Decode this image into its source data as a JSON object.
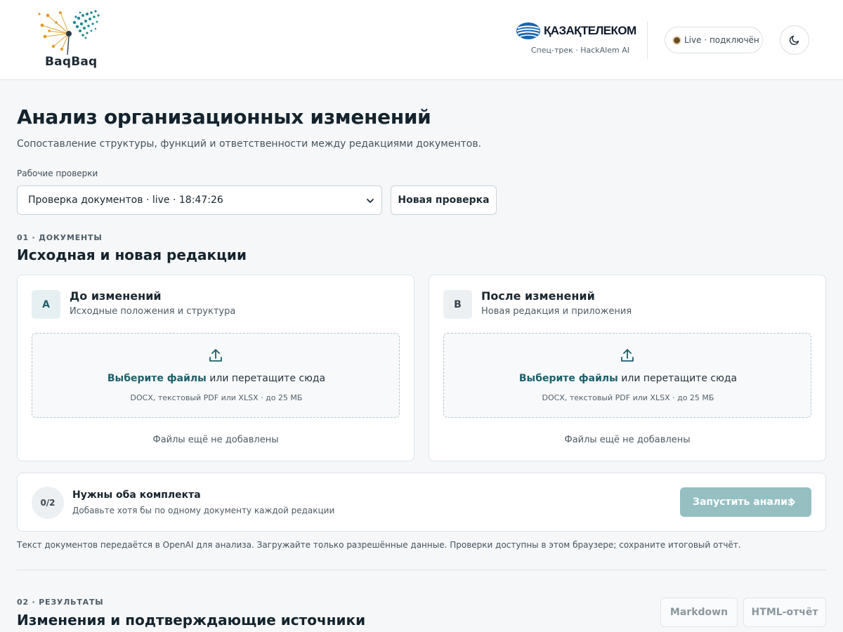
{
  "header": {
    "logo_text": "BaqBaq",
    "partner_name": "ҚАЗАҚТЕЛЕКОМ",
    "partner_sub": "Спец-трек · HackAlem AI",
    "live_status": "Live · подключён"
  },
  "main": {
    "title": "Анализ организационных изменений",
    "subtitle": "Сопоставление структуры, функций и ответственности между редакциями документов.",
    "checks_label": "Рабочие проверки",
    "selected_check": "Проверка документов · live · 18:47:26",
    "new_check_label": "Новая проверка"
  },
  "documents": {
    "kicker": "01 · ДОКУМЕНТЫ",
    "title": "Исходная и новая редакции",
    "cards": [
      {
        "badge": "A",
        "title": "До изменений",
        "subtitle": "Исходные положения и структура",
        "drop_link": "Выберите файлы",
        "drop_text": " или перетащите сюда",
        "drop_hint": "DOCX, текстовый PDF или XLSX · до 25 МБ",
        "empty_text": "Файлы ещё не добавлены"
      },
      {
        "badge": "B",
        "title": "После изменений",
        "subtitle": "Новая редакция и приложения",
        "drop_link": "Выберите файлы",
        "drop_text": " или перетащите сюда",
        "drop_hint": "DOCX, текстовый PDF или XLSX · до 25 МБ",
        "empty_text": "Файлы ещё не добавлены"
      }
    ],
    "status": {
      "counter": "0/2",
      "title": "Нужны оба комплекта",
      "subtitle": "Добавьте хотя бы по одному документу каждой редакции",
      "run_label": "Запустить анализ"
    },
    "disclaimer": "Текст документов передаётся в OpenAI для анализа. Загружайте только разрешённые данные. Проверки доступны в этом браузере; сохраните итоговый отчёт."
  },
  "results": {
    "kicker": "02 · РЕЗУЛЬТАТЫ",
    "title": "Изменения и подтверждающие источники",
    "export_markdown": "Markdown",
    "export_html": "HTML-отчёт"
  },
  "colors": {
    "accent": "#1d5f6a",
    "run_button_disabled": "#96bfc2",
    "background": "#f5f7f9"
  },
  "icons": {
    "logo": "dandelion-logo-icon",
    "partner": "globe-icon",
    "live": "status-dot-icon",
    "theme": "moon-icon",
    "select": "chevron-down-icon",
    "upload": "upload-icon",
    "run": "chevron-right-icon"
  }
}
